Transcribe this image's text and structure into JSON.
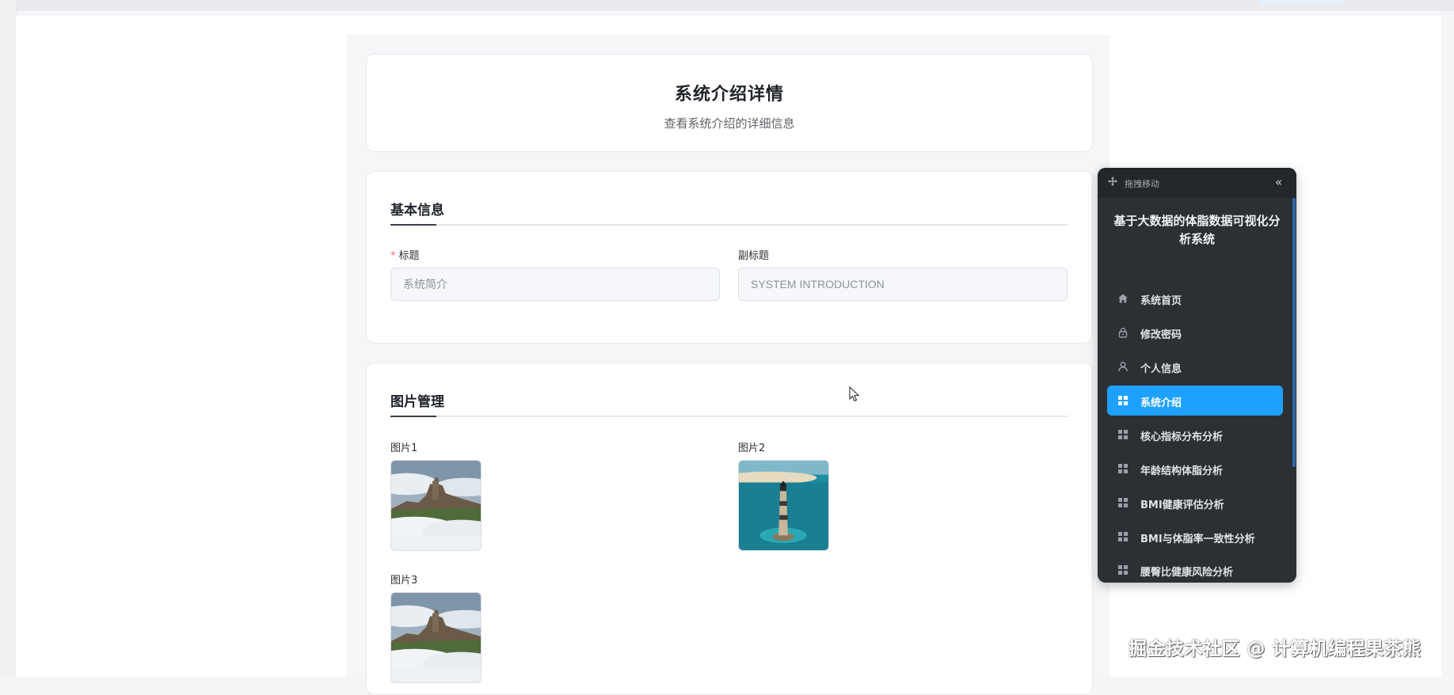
{
  "header": {
    "title": "系统介绍详情",
    "subtitle": "查看系统介绍的详细信息"
  },
  "basic_info": {
    "section_title": "基本信息",
    "title_label": "标题",
    "title_required_mark": "*",
    "title_value": "系统简介",
    "subtitle_label": "副标题",
    "subtitle_value": "SYSTEM INTRODUCTION"
  },
  "image_management": {
    "section_title": "图片管理",
    "images": [
      {
        "label": "图片1",
        "subject": "hilltop-village-in-clouds"
      },
      {
        "label": "图片2",
        "subject": "lighthouse-in-sea"
      },
      {
        "label": "图片3",
        "subject": "hilltop-village-in-clouds"
      }
    ]
  },
  "floating_sidebar": {
    "drag_label": "拖拽移动",
    "collapse_icon": "double-chevron-left",
    "app_title": "基于大数据的体脂数据可视化分析系统",
    "active_item": "系统介绍",
    "items": [
      {
        "label": "系统首页",
        "icon": "home-icon"
      },
      {
        "label": "修改密码",
        "icon": "lock-icon"
      },
      {
        "label": "个人信息",
        "icon": "user-icon"
      },
      {
        "label": "系统介绍",
        "icon": "grid-icon"
      },
      {
        "label": "核心指标分布分析",
        "icon": "grid-icon"
      },
      {
        "label": "年龄结构体脂分析",
        "icon": "grid-icon"
      },
      {
        "label": "BMI健康评估分析",
        "icon": "grid-icon"
      },
      {
        "label": "BMI与体脂率一致性分析",
        "icon": "grid-icon"
      },
      {
        "label": "腰臀比健康风险分析",
        "icon": "grid-icon"
      }
    ]
  },
  "watermark": "掘金技术社区 @ 计算机编程果茶熊",
  "colors": {
    "active_menu": "#1ea0ff",
    "sidebar_bg": "#2c2f33",
    "required_mark": "#f56c6c"
  }
}
